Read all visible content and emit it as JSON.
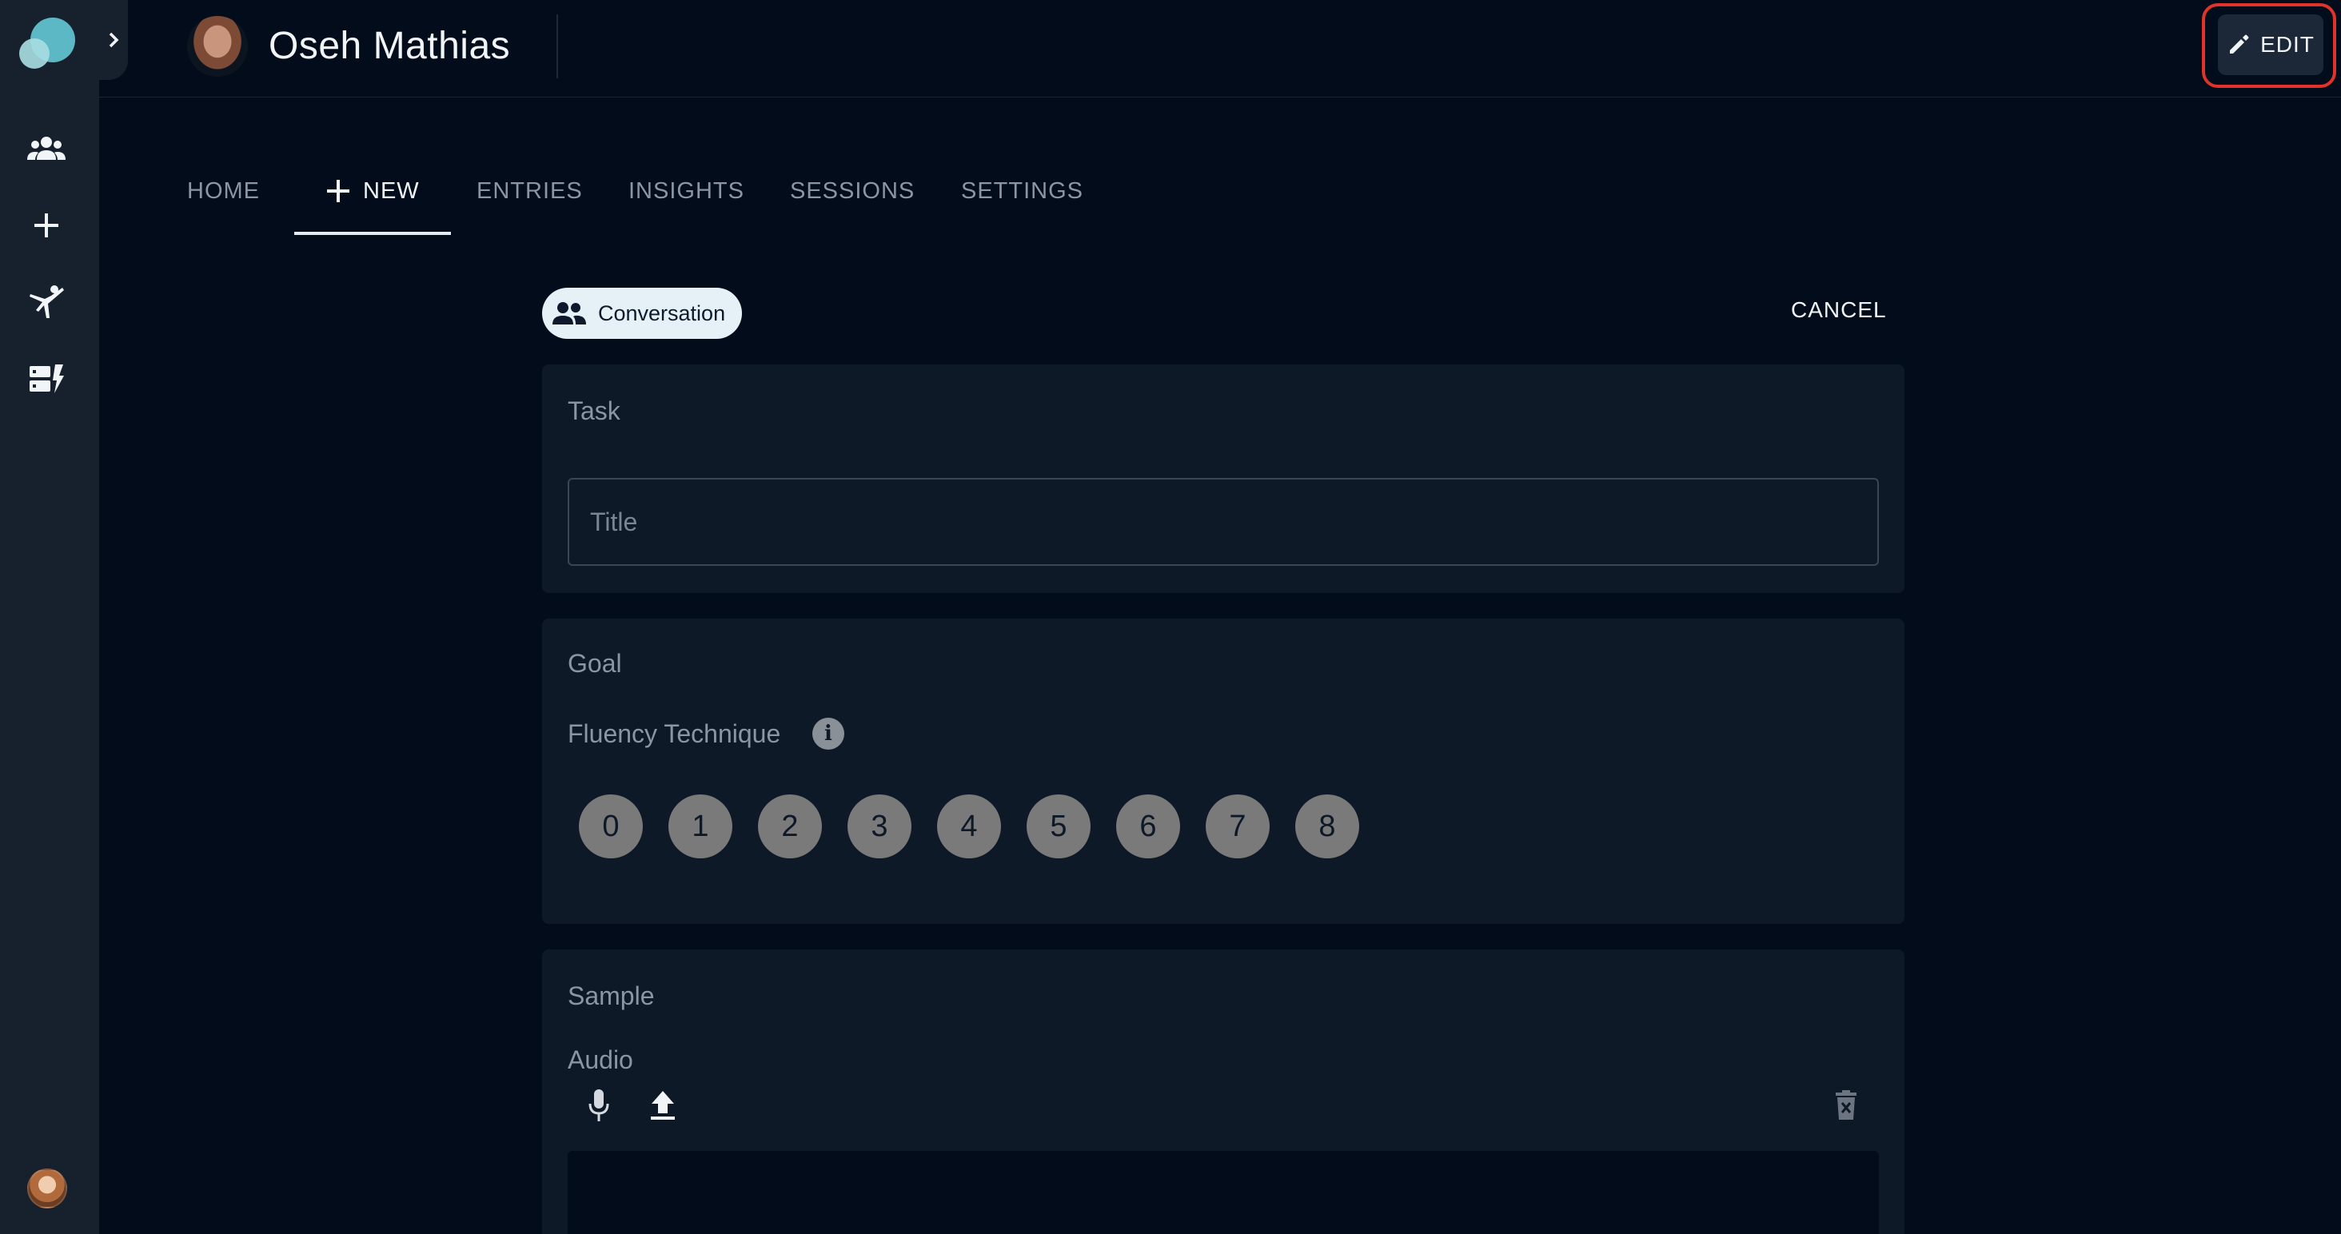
{
  "header": {
    "patient_name": "Oseh Mathias",
    "edit_label": "EDIT"
  },
  "tabs": [
    {
      "label": "HOME"
    },
    {
      "label": "NEW"
    },
    {
      "label": "ENTRIES"
    },
    {
      "label": "INSIGHTS"
    },
    {
      "label": "SESSIONS"
    },
    {
      "label": "SETTINGS"
    }
  ],
  "active_tab": "NEW",
  "form": {
    "type_chip": "Conversation",
    "cancel_label": "CANCEL",
    "task": {
      "section_title": "Task",
      "title_placeholder": "Title",
      "title_value": ""
    },
    "goal": {
      "section_title": "Goal",
      "fluency_label": "Fluency Technique",
      "info_glyph": "i",
      "scores": [
        "0",
        "1",
        "2",
        "3",
        "4",
        "5",
        "6",
        "7",
        "8"
      ]
    },
    "sample": {
      "section_title": "Sample",
      "audio_label": "Audio"
    }
  },
  "icons": {
    "sidebar": [
      "patients-icon",
      "add-icon",
      "exercise-icon",
      "dashboard-icon"
    ],
    "audio_tools": [
      "microphone-icon",
      "upload-icon",
      "delete-icon"
    ]
  },
  "colors": {
    "background": "#020c1b",
    "sidebar": "#17212e",
    "card": "#0e1928",
    "chip": "#e5f1f7",
    "score_circle": "#7a7a7a",
    "highlight": "#e0332a",
    "logo": "#5bb8c4"
  }
}
